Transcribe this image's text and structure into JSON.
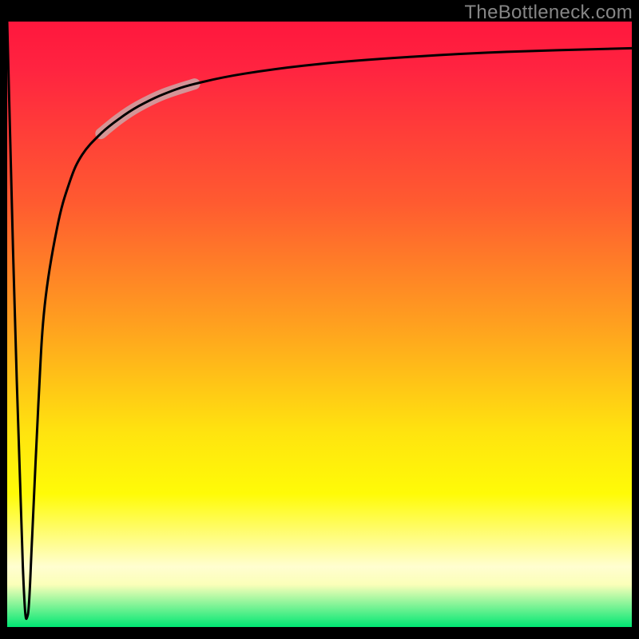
{
  "watermark": "TheBottleneck.com",
  "colors": {
    "background": "#000000",
    "gradient_top": "#ff173d",
    "gradient_bottom": "#00e773",
    "curve": "#000000",
    "highlight": "#cda6a7",
    "watermark_text": "#868686"
  },
  "chart_data": {
    "type": "line",
    "title": "",
    "xlabel": "",
    "ylabel": "",
    "xlim": [
      0,
      100
    ],
    "ylim": [
      0,
      100
    ],
    "series": [
      {
        "name": "bottleneck-curve",
        "x": [
          0,
          1,
          2.5,
          3.3,
          4,
          5,
          6,
          8,
          10,
          12,
          15,
          18,
          21,
          25,
          30,
          38,
          50,
          65,
          80,
          100
        ],
        "values": [
          100,
          60,
          10,
          2,
          15,
          37,
          53,
          66,
          73.5,
          78,
          81.5,
          84,
          86,
          88,
          89.7,
          91.4,
          93,
          94.2,
          95,
          95.6
        ]
      }
    ],
    "highlight_segment": {
      "x_start": 18,
      "x_end": 25
    },
    "grid": false,
    "legend": false
  }
}
